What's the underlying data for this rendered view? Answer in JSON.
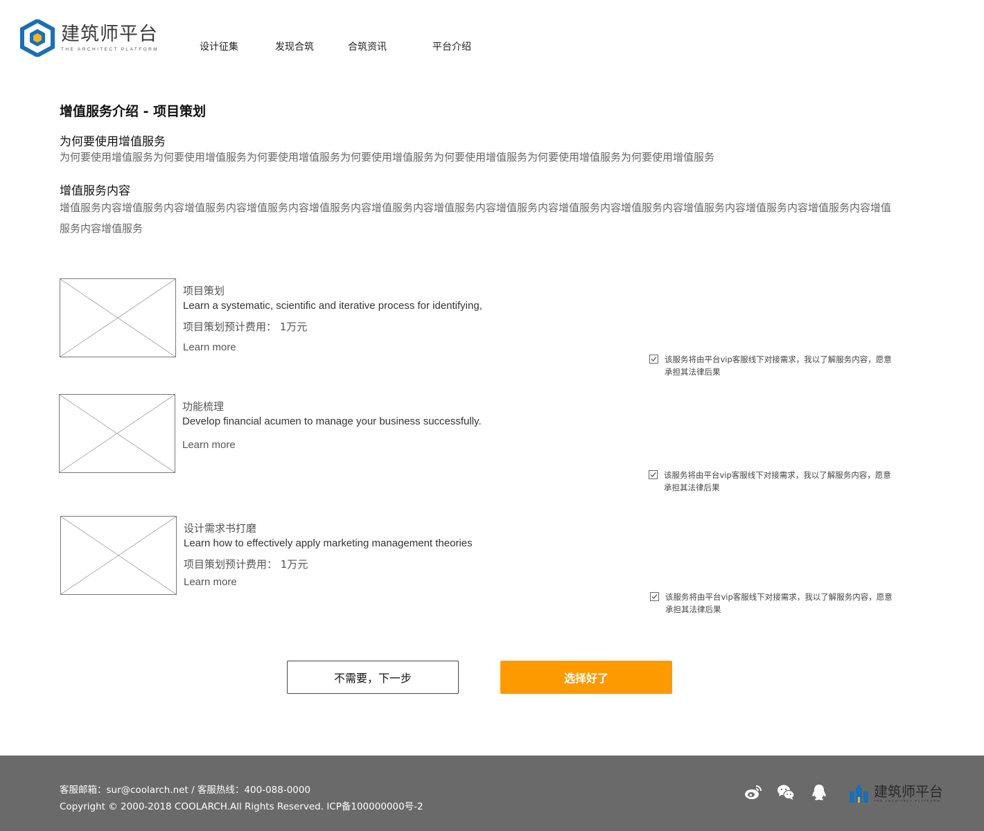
{
  "header": {
    "logo": {
      "cn": "建筑师平台",
      "en": "THE ARCHITECT PLATFORM"
    },
    "nav": [
      "设计征集",
      "发现合筑",
      "合筑资讯",
      "平台介绍"
    ]
  },
  "main": {
    "title": "增值服务介绍 - 项目策划",
    "why_title": "为何要使用增值服务",
    "why_text": "为何要使用增值服务为何要使用增值服务为何要使用增值服务为何要使用增值服务为何要使用增值服务为何要使用增值服务为何要使用增值服务",
    "content_title": "增值服务内容",
    "content_text": "增值服务内容增值服务内容增值服务内容增值服务内容增值服务内容增值服务内容增值服务内容增值服务内容增值服务内容增值服务内容增值服务内容增值服务内容增值服务内容增值服务内容增值服务",
    "services": [
      {
        "name": "项目策划",
        "desc": "Learn a systematic, scientific and iterative process for identifying,",
        "fee": "项目策划预计费用： 1万元",
        "more": "Learn more",
        "agree": "该服务将由平台vip客服线下对接需求，我以了解服务内容，愿意承担其法律后果",
        "checked": true
      },
      {
        "name": "功能梳理",
        "desc": "Develop financial acumen to manage your business successfully.",
        "more": "Learn more",
        "agree": "该服务将由平台vip客服线下对接需求，我以了解服务内容，愿意承担其法律后果",
        "checked": true
      },
      {
        "name": "设计需求书打磨",
        "desc": "Learn how to effectively apply marketing management theories",
        "fee": "项目策划预计费用： 1万元",
        "more": "Learn more",
        "agree": "该服务将由平台vip客服线下对接需求，我以了解服务内容，愿意承担其法律后果",
        "checked": true
      }
    ],
    "buttons": {
      "skip": "不需要，下一步",
      "confirm": "选择好了"
    }
  },
  "footer": {
    "contact": "客服邮箱：sur@coolarch.net / 客服热线：400-088-0000",
    "copyright": "Copyright © 2000-2018 COOLARCH.All Rights Reserved.   ICP备100000000号-2",
    "icons": [
      "weibo-icon",
      "wechat-icon",
      "qq-icon"
    ],
    "logo": {
      "cn": "建筑师平台",
      "en": "THE ARCHITECT PLATFORM"
    }
  },
  "colors": {
    "accent": "#fd9a00",
    "footer_bg": "#6a6a6a",
    "logo_blue": "#1b6fb5"
  }
}
